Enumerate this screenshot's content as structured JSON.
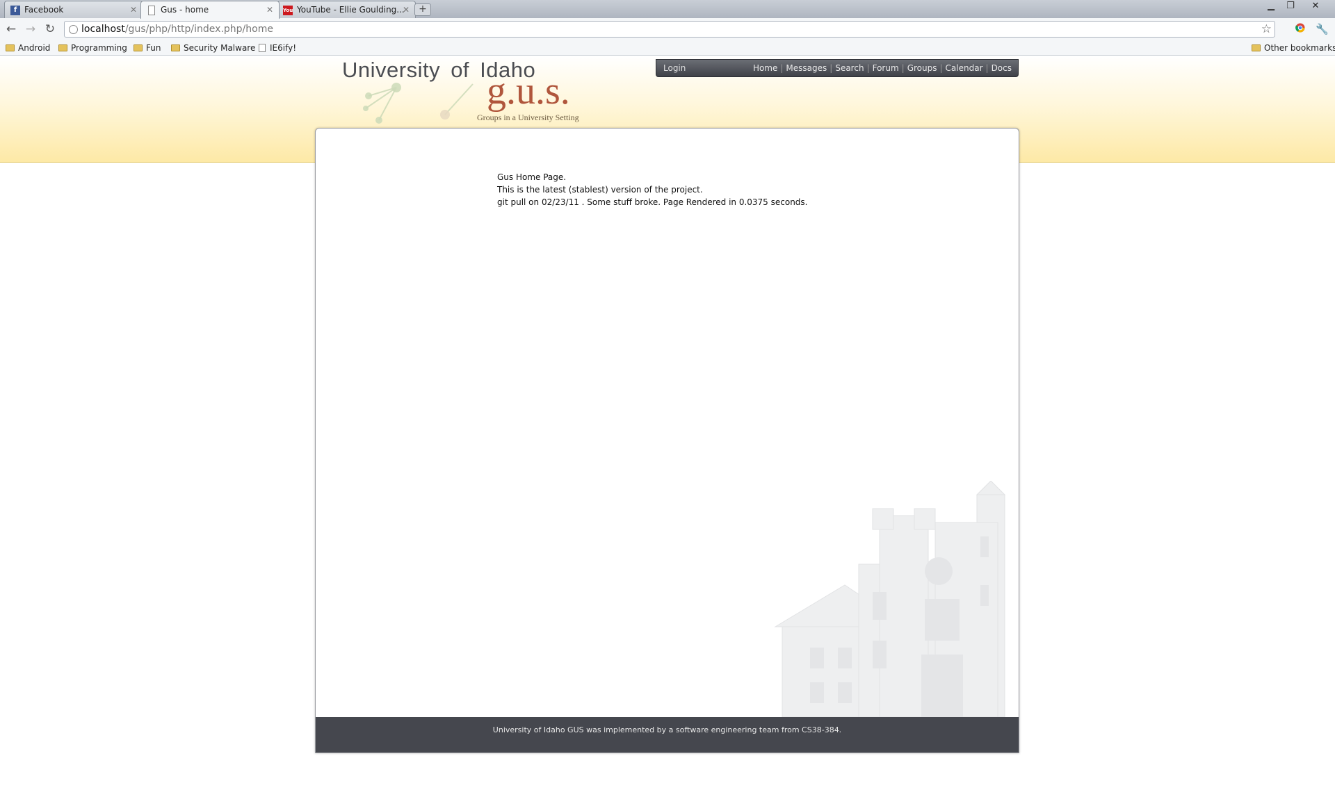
{
  "tabs": [
    {
      "title": "Facebook",
      "icon": "facebook-icon"
    },
    {
      "title": "Gus - home",
      "icon": "page-icon",
      "active": true
    },
    {
      "title": "YouTube - Ellie Goulding...",
      "icon": "youtube-icon"
    }
  ],
  "toolbar": {
    "url_host": "localhost",
    "url_path": "/gus/php/http/index.php/home"
  },
  "bookmarks": {
    "items": [
      "Android",
      "Programming",
      "Fun",
      "Security Malware",
      "IE6ify!"
    ],
    "other": "Other bookmarks"
  },
  "site": {
    "university": "University of Idaho",
    "name": "g.u.s.",
    "tagline": "Groups in a University Setting"
  },
  "nav": {
    "login": "Login",
    "links": [
      "Home",
      "Messages",
      "Search",
      "Forum",
      "Groups",
      "Calendar",
      "Docs"
    ]
  },
  "content": {
    "line1": "Gus Home Page.",
    "line2": "This is the latest (stablest) version of the project.",
    "line3": "git pull on 02/23/11 . Some stuff broke. Page Rendered in 0.0375 seconds."
  },
  "footer": {
    "text": "University of Idaho GUS was implemented by a software engineering team from CS38-384."
  }
}
